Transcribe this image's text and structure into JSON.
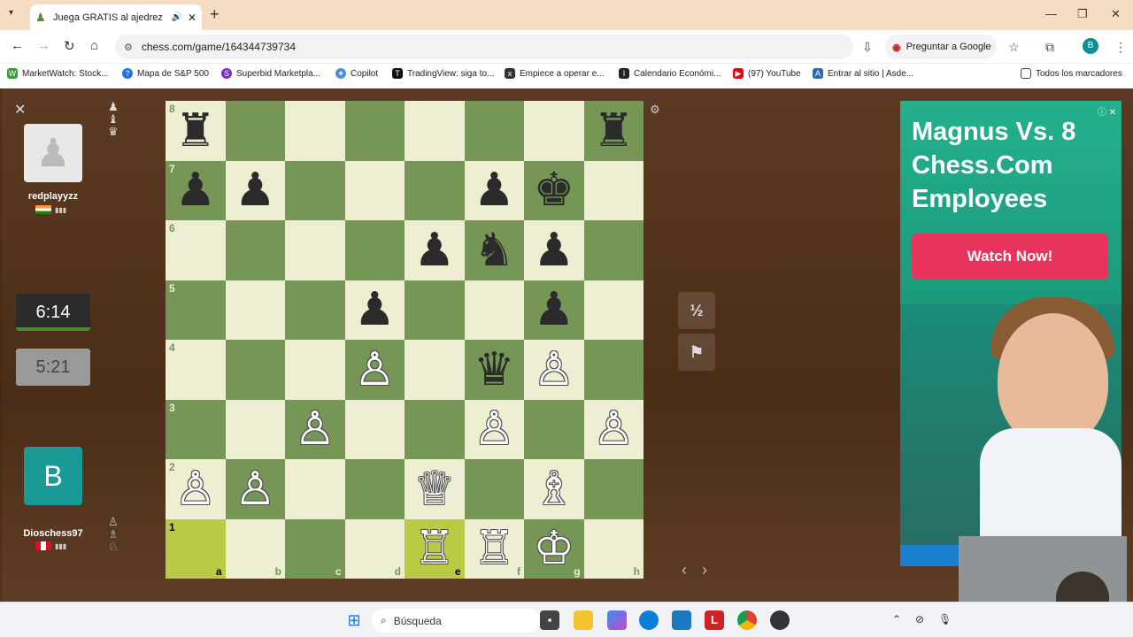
{
  "browser": {
    "tab_title": "Juega GRATIS al ajedrez onl",
    "url": "chess.com/game/164344739734",
    "google_button": "Preguntar a Google",
    "avatar_letter": "B",
    "bookmarks": [
      "MarketWatch: Stock...",
      "Mapa de S&P 500",
      "Superbid Marketpla...",
      "Copilot",
      "TradingView: siga to...",
      "Empiece a operar e...",
      "Calendario Económi...",
      "(97) YouTube",
      "Entrar al sitio | Asde..."
    ],
    "all_bookmarks": "Todos los marcadores"
  },
  "game": {
    "top_player": {
      "name": "redplayyzz",
      "flag": "India",
      "clock": "6:14"
    },
    "bottom_player": {
      "name": "Dioschess97",
      "flag": "Peru",
      "clock": "5:21",
      "avatar_letter": "B"
    },
    "draw_label": "½",
    "ranks": [
      "8",
      "7",
      "6",
      "5",
      "4",
      "3",
      "2",
      "1"
    ],
    "files": [
      "a",
      "b",
      "c",
      "d",
      "e",
      "f",
      "g",
      "h"
    ],
    "highlight_squares": [
      "a1",
      "e1"
    ],
    "pieces": {
      "a8": "♜",
      "h8": "♜",
      "a7": "♟",
      "b7": "♟",
      "f7": "♟",
      "g7": "♚",
      "e6": "♟",
      "f6": "♞",
      "g6": "♟",
      "d5": "♟",
      "g5": "♟",
      "d4": "♙",
      "f4": "♛",
      "g4": "♙",
      "c3": "♙",
      "f3": "♙",
      "h3": "♙",
      "a2": "♙",
      "b2": "♙",
      "e2": "♕",
      "g2": "♗",
      "e1": "♖",
      "f1": "♖",
      "g1": "♔"
    }
  },
  "ad": {
    "headline": "Magnus Vs. 8 Chess.Com Employees",
    "cta": "Watch Now!"
  },
  "taskbar": {
    "search_placeholder": "Búsqueda"
  }
}
